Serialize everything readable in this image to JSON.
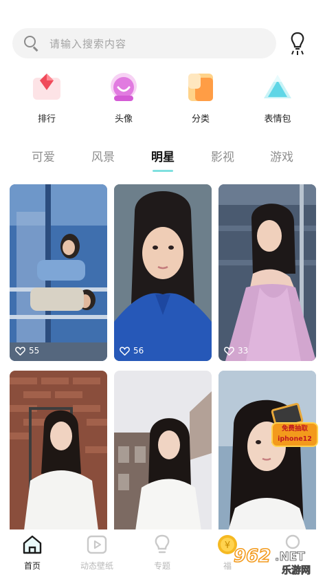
{
  "search": {
    "placeholder": "请输入搜索内容"
  },
  "categories": [
    {
      "label": "排行",
      "icon": "ranking-icon"
    },
    {
      "label": "头像",
      "icon": "avatar-icon"
    },
    {
      "label": "分类",
      "icon": "category-icon"
    },
    {
      "label": "表情包",
      "icon": "sticker-icon"
    }
  ],
  "tabs": [
    {
      "label": "可爱"
    },
    {
      "label": "风景"
    },
    {
      "label": "明星",
      "active": true
    },
    {
      "label": "影视"
    },
    {
      "label": "游戏"
    }
  ],
  "cards": [
    {
      "likes": "55"
    },
    {
      "likes": "56"
    },
    {
      "likes": "33"
    },
    {
      "likes": ""
    },
    {
      "likes": ""
    },
    {
      "likes": ""
    }
  ],
  "promo": {
    "line1": "免费抽取",
    "line2": "iphone12"
  },
  "nav": [
    {
      "label": "首页",
      "icon": "home-icon",
      "active": true
    },
    {
      "label": "动态壁纸",
      "icon": "play-icon"
    },
    {
      "label": "专题",
      "icon": "bulb-icon"
    },
    {
      "label": "福",
      "icon": "coin-icon"
    },
    {
      "label": "",
      "icon": "profile-icon"
    }
  ],
  "watermark": {
    "brand": "962",
    "suffix": ".NET",
    "sub": "乐游网"
  },
  "colors": {
    "accent": "#7fe0df",
    "inactive": "#8e8e8e",
    "search_bg": "#f3f3f3"
  }
}
